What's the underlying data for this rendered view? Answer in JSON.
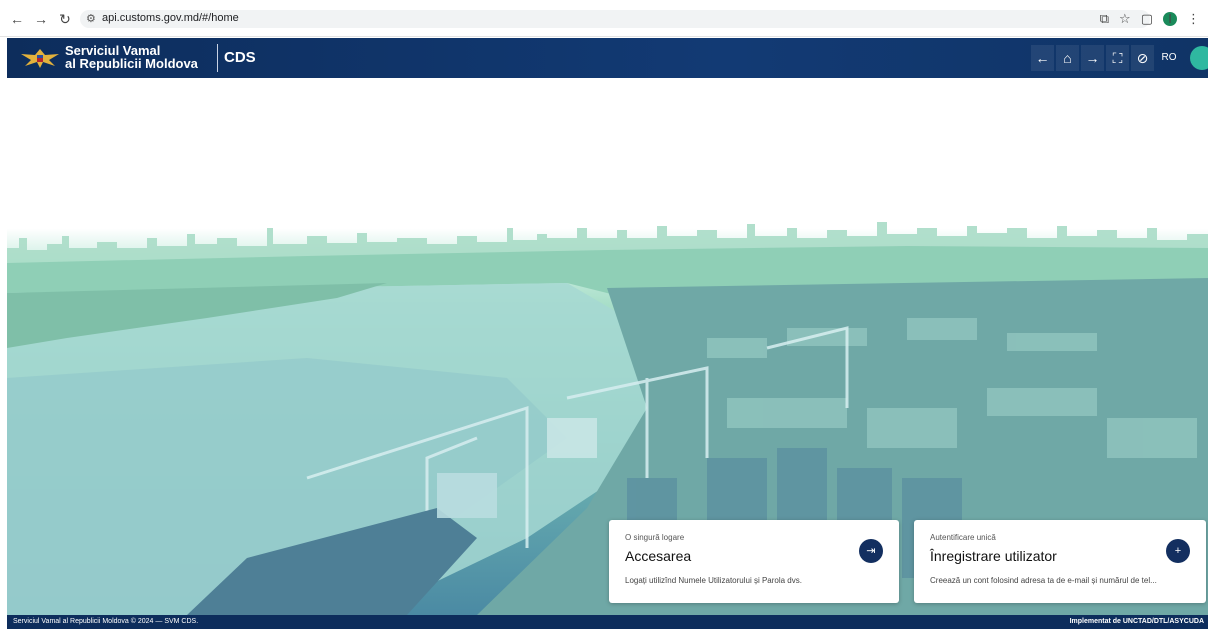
{
  "browser": {
    "back_icon": "arrow-back-icon",
    "forward_icon": "arrow-forward-icon",
    "reload_icon": "reload-icon",
    "url": "api.customs.gov.md/#/home",
    "profile_initial": "I"
  },
  "header": {
    "brand_line1": "Serviciul Vamal",
    "brand_line2": "al Republicii Moldova",
    "app_code": "CDS",
    "language": "RO",
    "colors": {
      "header_bg": "#0d2d5c",
      "accent": "#2fb8a0"
    }
  },
  "cards": [
    {
      "eyebrow": "O singură logare",
      "title": "Accesarea",
      "description": "Logați utilizînd Numele Utilizatorului și Parola dvs.",
      "icon": "login-icon"
    },
    {
      "eyebrow": "Autentificare unică",
      "title": "Înregistrare utilizator",
      "description": "Creează un cont folosind adresa ta de e-mail și numărul de tel...",
      "icon": "add-user-icon"
    }
  ],
  "footer": {
    "left": "Serviciul Vamal al Republicii Moldova © 2024 — SVM CDS.",
    "right": "Implementat de UNCTAD/DTL/ASYCUDA"
  }
}
